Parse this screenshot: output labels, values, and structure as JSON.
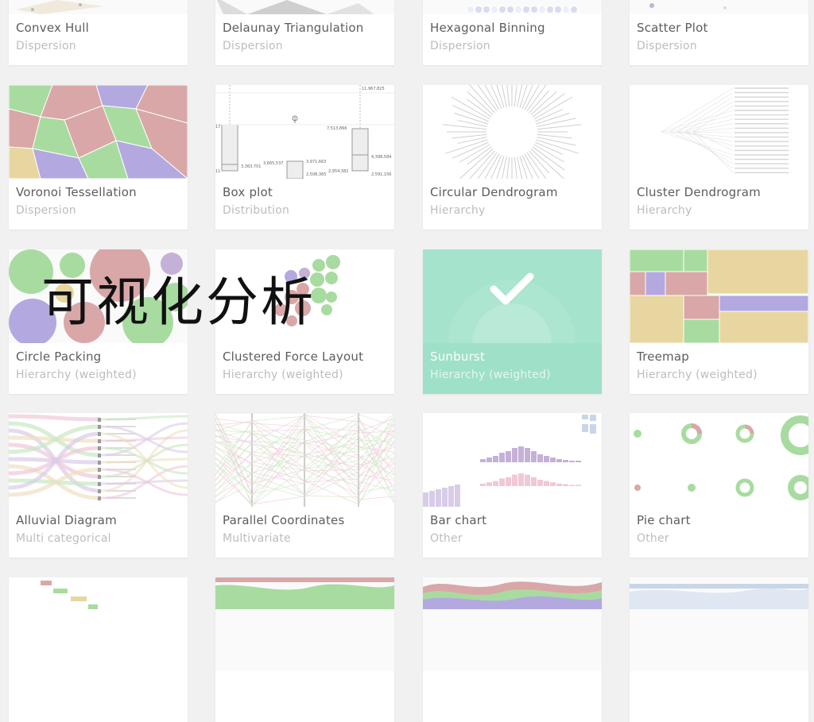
{
  "colors": {
    "background": "#f1f1f1",
    "selected_card": "#9fe0c8",
    "palette": [
      "#a8dba0",
      "#d9a7a7",
      "#b3a9e0",
      "#e8d6a0",
      "#c5b0d8",
      "#f0c8d8"
    ]
  },
  "overlay_text": "可视化分析",
  "cards": [
    {
      "title": "Convex Hull",
      "category": "Dispersion"
    },
    {
      "title": "Delaunay Triangulation",
      "category": "Dispersion"
    },
    {
      "title": "Hexagonal Binning",
      "category": "Dispersion"
    },
    {
      "title": "Scatter Plot",
      "category": "Dispersion"
    },
    {
      "title": "Voronoi Tessellation",
      "category": "Dispersion"
    },
    {
      "title": "Box plot",
      "category": "Distribution"
    },
    {
      "title": "Circular Dendrogram",
      "category": "Hierarchy"
    },
    {
      "title": "Cluster Dendrogram",
      "category": "Hierarchy"
    },
    {
      "title": "Circle Packing",
      "category": "Hierarchy (weighted)"
    },
    {
      "title": "Clustered Force Layout",
      "category": "Hierarchy (weighted)"
    },
    {
      "title": "Sunburst",
      "category": "Hierarchy (weighted)",
      "selected": true,
      "selected_icon": "checkmark-icon"
    },
    {
      "title": "Treemap",
      "category": "Hierarchy (weighted)"
    },
    {
      "title": "Alluvial Diagram",
      "category": "Multi categorical"
    },
    {
      "title": "Parallel Coordinates",
      "category": "Multivariate"
    },
    {
      "title": "Bar chart",
      "category": "Other"
    },
    {
      "title": "Pie chart",
      "category": "Other"
    }
  ],
  "box_plot_labels": [
    "11,967,825",
    "7,513,866",
    "4,398,584",
    "3,363,701",
    "3,665,537",
    "3,971,663",
    "2,508,365",
    "2,954,382",
    "2,591,156",
    "17",
    "11"
  ]
}
